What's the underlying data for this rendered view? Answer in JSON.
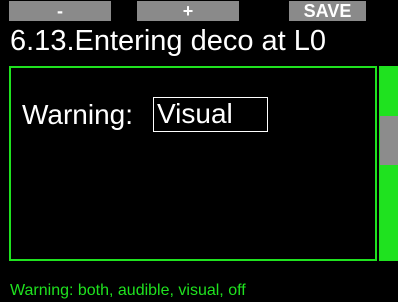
{
  "softkeys": {
    "minus_label": "-",
    "plus_label": "+",
    "save_label": "SAVE"
  },
  "header": {
    "title": "6.13.Entering deco at L0"
  },
  "setting": {
    "label": "Warning:",
    "value": "Visual"
  },
  "footer": {
    "hint": "Warning: both, audible, visual, off"
  },
  "colors": {
    "accent": "#1fe21f",
    "softkey": "#8a8a8a",
    "background": "#000000",
    "text": "#ffffff"
  }
}
